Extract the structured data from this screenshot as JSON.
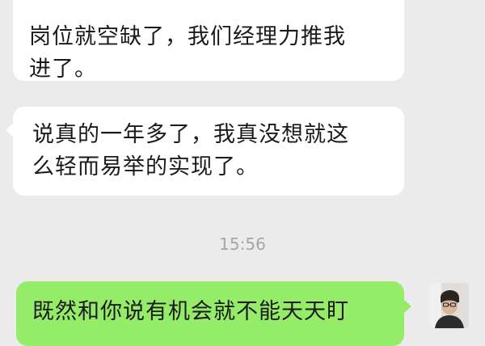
{
  "chat": {
    "messages": [
      {
        "direction": "incoming",
        "lines": [
          "岗位就空缺了，我们经理力推我",
          "进了。"
        ],
        "partial_top_line_cut_off": true
      },
      {
        "direction": "incoming",
        "lines": [
          "说真的一年多了，我真没想就这",
          "么轻而易举的实现了。"
        ]
      },
      {
        "direction": "outgoing",
        "lines": [
          "既然和你说有机会就不能天天盯"
        ]
      }
    ],
    "timestamp": "15:56"
  },
  "theme": {
    "background": "#ebebeb",
    "incoming_bubble": "#ffffff",
    "outgoing_bubble": "#95ec69",
    "text_color": "#1a1a1a",
    "timestamp_color": "#a6a6a6"
  },
  "icons": {
    "avatar": "user-avatar-photo"
  }
}
